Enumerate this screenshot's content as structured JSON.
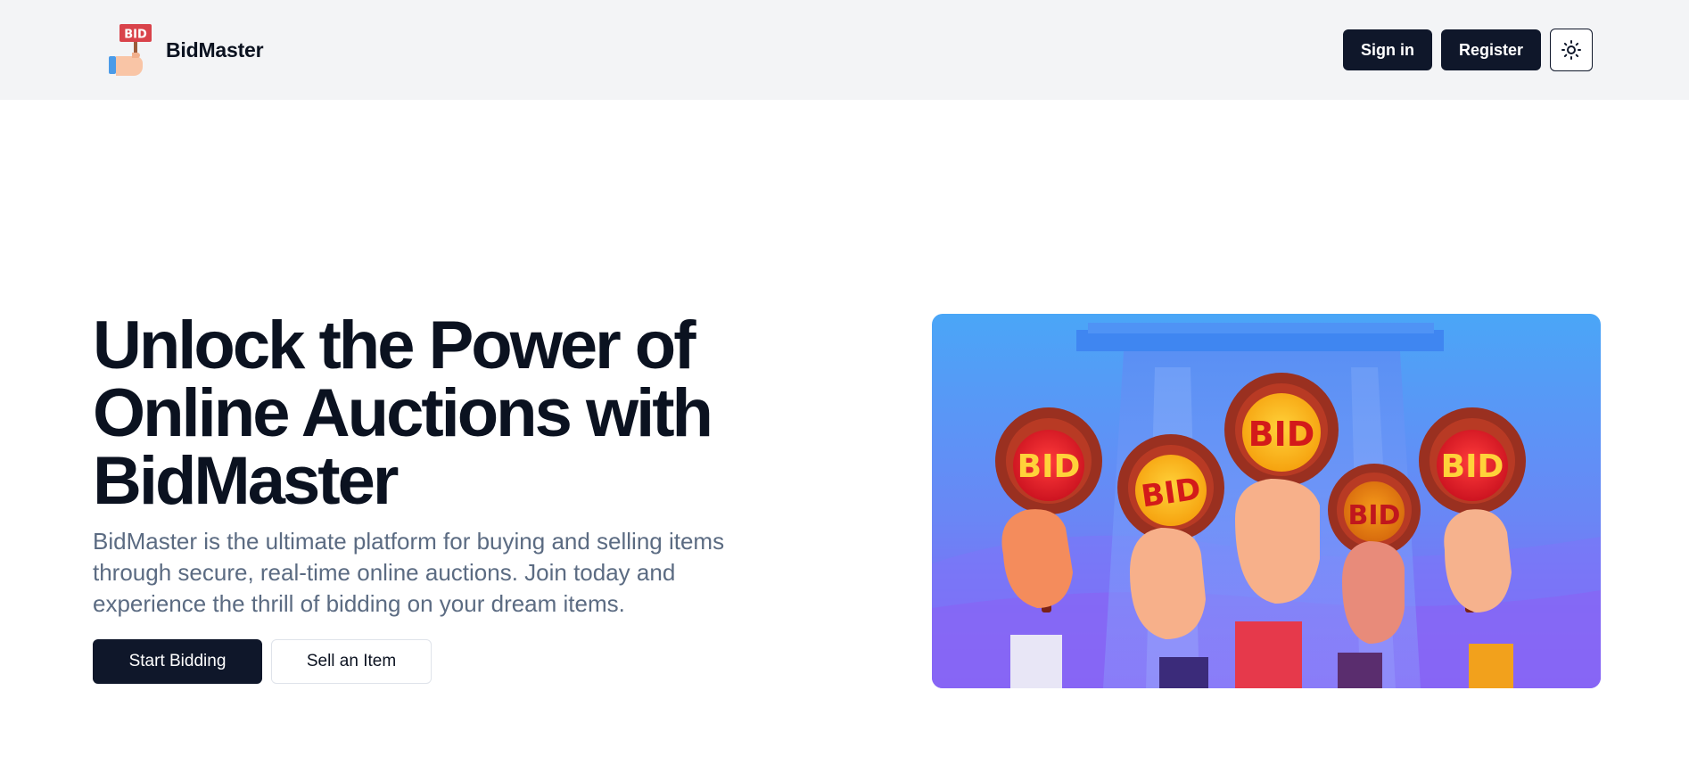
{
  "header": {
    "brand_name": "BidMaster",
    "logo_label": "BID",
    "signin_label": "Sign in",
    "register_label": "Register",
    "theme_icon": "sun-icon"
  },
  "hero": {
    "title": "Unlock the Power of Online Auctions with BidMaster",
    "description": "BidMaster is the ultimate platform for buying and selling items through secure, real-time online auctions. Join today and experience the thrill of bidding on your dream items.",
    "primary_button": "Start Bidding",
    "secondary_button": "Sell an Item",
    "paddle_label": "BID"
  },
  "colors": {
    "dark": "#0f172a",
    "header_bg": "#f3f4f6",
    "muted_text": "#5b6b82",
    "image_top": "#4aa6f7",
    "image_bottom": "#8a5cf6"
  }
}
